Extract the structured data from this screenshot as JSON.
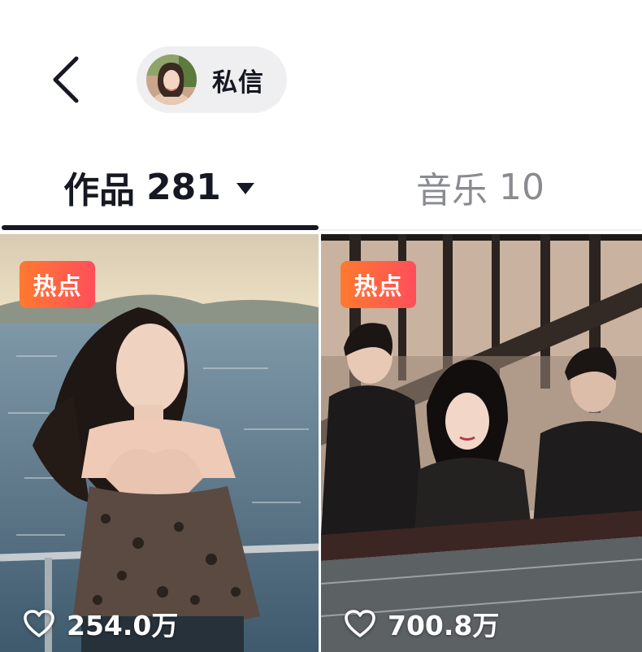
{
  "header": {
    "back_icon": "chevron-left-icon",
    "message_label": "私信",
    "avatar_icon": "user-avatar"
  },
  "tabs": [
    {
      "label": "作品",
      "count": "281",
      "active": true,
      "has_dropdown": true
    },
    {
      "label": "音乐",
      "count": "10",
      "active": false
    }
  ],
  "videos": [
    {
      "badge": "热点",
      "likes": "254.0万",
      "like_icon": "heart-icon"
    },
    {
      "badge": "热点",
      "likes": "700.8万",
      "like_icon": "heart-icon"
    }
  ],
  "colors": {
    "text_primary": "#161823",
    "text_secondary": "#8a8b91",
    "pill_bg": "#efeff1",
    "badge_start": "#ff7a2f",
    "badge_end": "#ff4e5a"
  }
}
